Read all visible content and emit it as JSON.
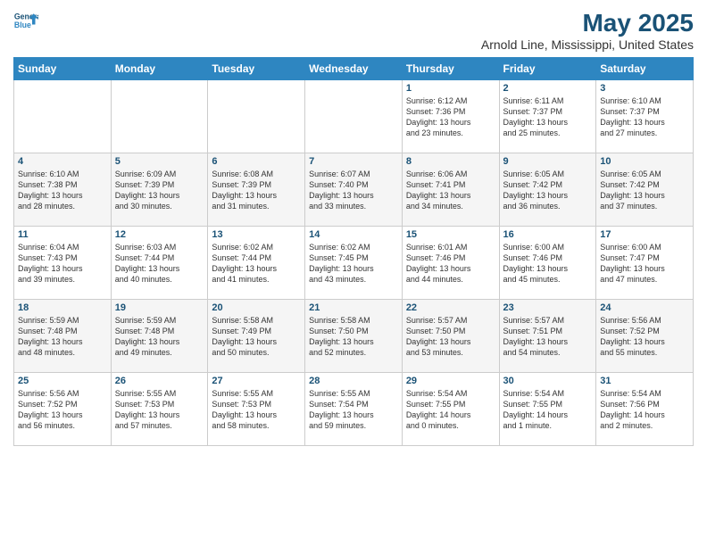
{
  "header": {
    "logo_line1": "General",
    "logo_line2": "Blue",
    "title": "May 2025",
    "subtitle": "Arnold Line, Mississippi, United States"
  },
  "weekdays": [
    "Sunday",
    "Monday",
    "Tuesday",
    "Wednesday",
    "Thursday",
    "Friday",
    "Saturday"
  ],
  "weeks": [
    [
      {
        "day": "",
        "info": ""
      },
      {
        "day": "",
        "info": ""
      },
      {
        "day": "",
        "info": ""
      },
      {
        "day": "",
        "info": ""
      },
      {
        "day": "1",
        "info": "Sunrise: 6:12 AM\nSunset: 7:36 PM\nDaylight: 13 hours\nand 23 minutes."
      },
      {
        "day": "2",
        "info": "Sunrise: 6:11 AM\nSunset: 7:37 PM\nDaylight: 13 hours\nand 25 minutes."
      },
      {
        "day": "3",
        "info": "Sunrise: 6:10 AM\nSunset: 7:37 PM\nDaylight: 13 hours\nand 27 minutes."
      }
    ],
    [
      {
        "day": "4",
        "info": "Sunrise: 6:10 AM\nSunset: 7:38 PM\nDaylight: 13 hours\nand 28 minutes."
      },
      {
        "day": "5",
        "info": "Sunrise: 6:09 AM\nSunset: 7:39 PM\nDaylight: 13 hours\nand 30 minutes."
      },
      {
        "day": "6",
        "info": "Sunrise: 6:08 AM\nSunset: 7:39 PM\nDaylight: 13 hours\nand 31 minutes."
      },
      {
        "day": "7",
        "info": "Sunrise: 6:07 AM\nSunset: 7:40 PM\nDaylight: 13 hours\nand 33 minutes."
      },
      {
        "day": "8",
        "info": "Sunrise: 6:06 AM\nSunset: 7:41 PM\nDaylight: 13 hours\nand 34 minutes."
      },
      {
        "day": "9",
        "info": "Sunrise: 6:05 AM\nSunset: 7:42 PM\nDaylight: 13 hours\nand 36 minutes."
      },
      {
        "day": "10",
        "info": "Sunrise: 6:05 AM\nSunset: 7:42 PM\nDaylight: 13 hours\nand 37 minutes."
      }
    ],
    [
      {
        "day": "11",
        "info": "Sunrise: 6:04 AM\nSunset: 7:43 PM\nDaylight: 13 hours\nand 39 minutes."
      },
      {
        "day": "12",
        "info": "Sunrise: 6:03 AM\nSunset: 7:44 PM\nDaylight: 13 hours\nand 40 minutes."
      },
      {
        "day": "13",
        "info": "Sunrise: 6:02 AM\nSunset: 7:44 PM\nDaylight: 13 hours\nand 41 minutes."
      },
      {
        "day": "14",
        "info": "Sunrise: 6:02 AM\nSunset: 7:45 PM\nDaylight: 13 hours\nand 43 minutes."
      },
      {
        "day": "15",
        "info": "Sunrise: 6:01 AM\nSunset: 7:46 PM\nDaylight: 13 hours\nand 44 minutes."
      },
      {
        "day": "16",
        "info": "Sunrise: 6:00 AM\nSunset: 7:46 PM\nDaylight: 13 hours\nand 45 minutes."
      },
      {
        "day": "17",
        "info": "Sunrise: 6:00 AM\nSunset: 7:47 PM\nDaylight: 13 hours\nand 47 minutes."
      }
    ],
    [
      {
        "day": "18",
        "info": "Sunrise: 5:59 AM\nSunset: 7:48 PM\nDaylight: 13 hours\nand 48 minutes."
      },
      {
        "day": "19",
        "info": "Sunrise: 5:59 AM\nSunset: 7:48 PM\nDaylight: 13 hours\nand 49 minutes."
      },
      {
        "day": "20",
        "info": "Sunrise: 5:58 AM\nSunset: 7:49 PM\nDaylight: 13 hours\nand 50 minutes."
      },
      {
        "day": "21",
        "info": "Sunrise: 5:58 AM\nSunset: 7:50 PM\nDaylight: 13 hours\nand 52 minutes."
      },
      {
        "day": "22",
        "info": "Sunrise: 5:57 AM\nSunset: 7:50 PM\nDaylight: 13 hours\nand 53 minutes."
      },
      {
        "day": "23",
        "info": "Sunrise: 5:57 AM\nSunset: 7:51 PM\nDaylight: 13 hours\nand 54 minutes."
      },
      {
        "day": "24",
        "info": "Sunrise: 5:56 AM\nSunset: 7:52 PM\nDaylight: 13 hours\nand 55 minutes."
      }
    ],
    [
      {
        "day": "25",
        "info": "Sunrise: 5:56 AM\nSunset: 7:52 PM\nDaylight: 13 hours\nand 56 minutes."
      },
      {
        "day": "26",
        "info": "Sunrise: 5:55 AM\nSunset: 7:53 PM\nDaylight: 13 hours\nand 57 minutes."
      },
      {
        "day": "27",
        "info": "Sunrise: 5:55 AM\nSunset: 7:53 PM\nDaylight: 13 hours\nand 58 minutes."
      },
      {
        "day": "28",
        "info": "Sunrise: 5:55 AM\nSunset: 7:54 PM\nDaylight: 13 hours\nand 59 minutes."
      },
      {
        "day": "29",
        "info": "Sunrise: 5:54 AM\nSunset: 7:55 PM\nDaylight: 14 hours\nand 0 minutes."
      },
      {
        "day": "30",
        "info": "Sunrise: 5:54 AM\nSunset: 7:55 PM\nDaylight: 14 hours\nand 1 minute."
      },
      {
        "day": "31",
        "info": "Sunrise: 5:54 AM\nSunset: 7:56 PM\nDaylight: 14 hours\nand 2 minutes."
      }
    ]
  ]
}
